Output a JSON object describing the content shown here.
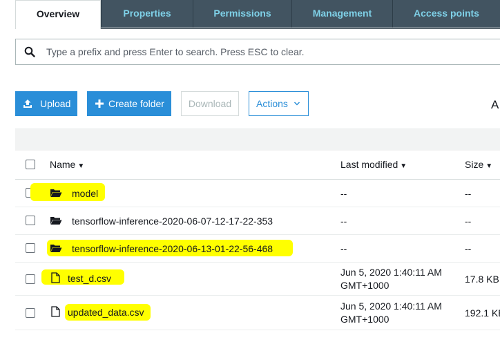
{
  "tabs": [
    {
      "label": "Overview",
      "active": true
    },
    {
      "label": "Properties",
      "active": false
    },
    {
      "label": "Permissions",
      "active": false
    },
    {
      "label": "Management",
      "active": false
    },
    {
      "label": "Access points",
      "active": false
    }
  ],
  "search": {
    "placeholder": "Type a prefix and press Enter to search. Press ESC to clear.",
    "value": ""
  },
  "toolbar": {
    "upload_label": "Upload",
    "create_folder_label": "Create folder",
    "download_label": "Download",
    "actions_label": "Actions",
    "truncated_right_text": "A"
  },
  "table": {
    "columns": {
      "name": "Name",
      "last_modified": "Last modified",
      "size": "Size"
    },
    "rows": [
      {
        "type": "folder",
        "name": "model",
        "modified_line1": "--",
        "modified_line2": "",
        "size": "--",
        "highlighted": true
      },
      {
        "type": "folder",
        "name": "tensorflow-inference-2020-06-07-12-17-22-353",
        "modified_line1": "--",
        "modified_line2": "",
        "size": "--",
        "highlighted": false
      },
      {
        "type": "folder",
        "name": "tensorflow-inference-2020-06-13-01-22-56-468",
        "modified_line1": "--",
        "modified_line2": "",
        "size": "--",
        "highlighted": true
      },
      {
        "type": "file",
        "name": "test_d.csv",
        "modified_line1": "Jun 5, 2020 1:40:11 AM",
        "modified_line2": "GMT+1000",
        "size": "17.8 KB",
        "highlighted": true
      },
      {
        "type": "file",
        "name": "updated_data.csv",
        "modified_line1": "Jun 5, 2020 1:40:11 AM",
        "modified_line2": "GMT+1000",
        "size": "192.1 KB",
        "highlighted": true
      }
    ]
  },
  "colors": {
    "accent": "#2a8ed8",
    "tab_bar": "#425461",
    "tab_text": "#7fd1e8",
    "highlight": "#ffff00"
  }
}
